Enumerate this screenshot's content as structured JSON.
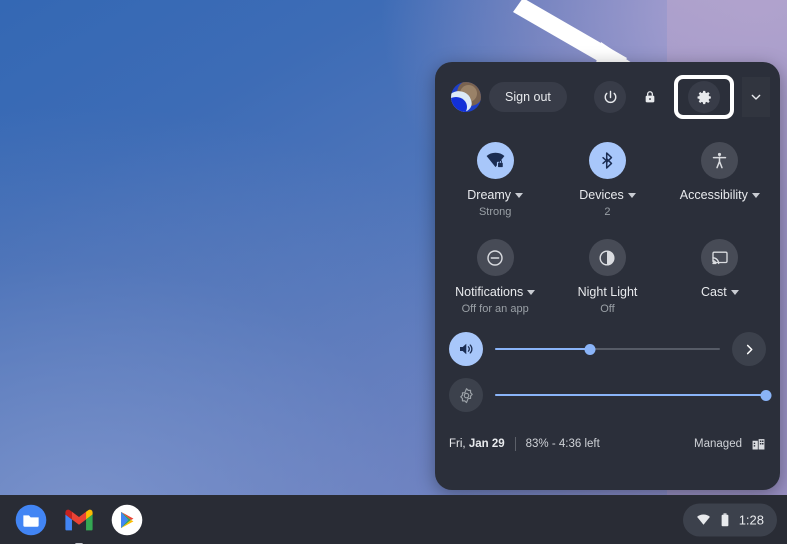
{
  "wallpaper": {
    "gradient_from": "#3468b4",
    "gradient_to": "#9a92c9"
  },
  "annotation": {
    "arrow_name": "pointer-arrow",
    "arrow_color": "#ffffff",
    "points_at": "settings-button"
  },
  "quick_settings": {
    "panel_background": "#2b2f3a",
    "header": {
      "avatar_name": "user-avatar",
      "sign_out_label": "Sign out",
      "power_icon": "power-icon",
      "lock_icon": "lock-icon",
      "settings_icon": "gear-icon",
      "collapse_icon": "chevron-down-icon",
      "highlight_color": "#ffffff"
    },
    "tiles": [
      {
        "label": "Dreamy",
        "sublabel": "Strong",
        "icon": "wifi-locked-icon",
        "state": "on",
        "has_caret": true
      },
      {
        "label": "Devices",
        "sublabel": "2",
        "icon": "bluetooth-icon",
        "state": "on",
        "has_caret": true
      },
      {
        "label": "Accessibility",
        "sublabel": "",
        "icon": "accessibility-icon",
        "state": "off",
        "has_caret": true
      },
      {
        "label": "Notifications",
        "sublabel": "Off for an app",
        "icon": "do-not-disturb-icon",
        "state": "off",
        "has_caret": true
      },
      {
        "label": "Night Light",
        "sublabel": "Off",
        "icon": "night-light-icon",
        "state": "off",
        "has_caret": false
      },
      {
        "label": "Cast",
        "sublabel": "",
        "icon": "cast-icon",
        "state": "off",
        "has_caret": true
      }
    ],
    "sliders": [
      {
        "name": "volume",
        "icon": "volume-up-icon",
        "state": "on",
        "value": 42,
        "expand_icon": "chevron-right-icon"
      },
      {
        "name": "brightness",
        "icon": "brightness-icon",
        "state": "off",
        "value": 100,
        "expand_icon": ""
      }
    ],
    "footer": {
      "date_prefix": "Fri, ",
      "date_value": "Jan 29",
      "battery": "83% - 4:36 left",
      "managed_label": "Managed",
      "managed_icon": "enterprise-icon"
    },
    "accent_color": "#a8c7fa",
    "slider_accent": "#8ab4f8"
  },
  "shelf": {
    "background": "#292c35",
    "apps": [
      {
        "name": "files-app",
        "label": "Files",
        "running": false
      },
      {
        "name": "gmail-app",
        "label": "Gmail",
        "running": true
      },
      {
        "name": "play-store-app",
        "label": "Play Store",
        "running": false
      }
    ],
    "tray": {
      "wifi_icon": "wifi-icon",
      "battery_icon": "battery-icon",
      "clock": "1:28"
    }
  }
}
